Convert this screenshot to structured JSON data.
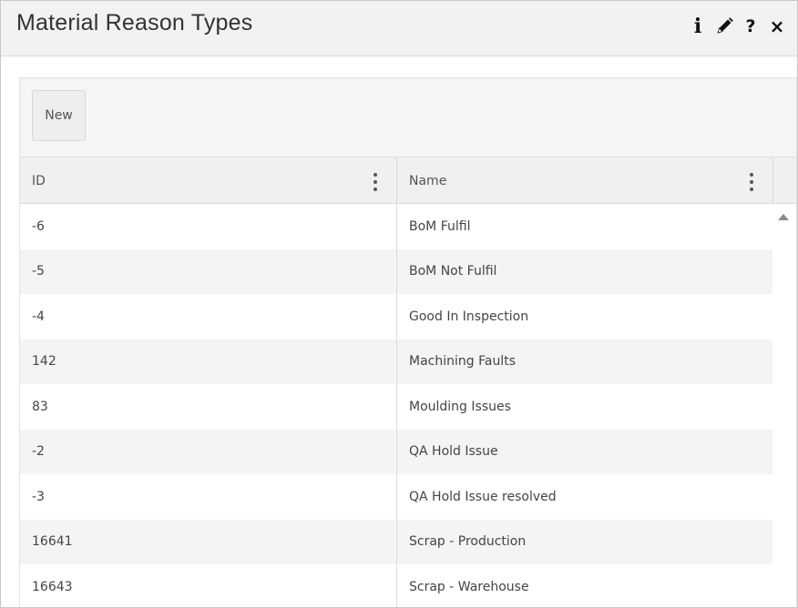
{
  "window": {
    "title": "Material Reason Types",
    "icons": {
      "info": "i",
      "edit": "edit-pencil",
      "help": "?",
      "close": "×"
    }
  },
  "toolbar": {
    "new_label": "New"
  },
  "grid": {
    "columns": [
      {
        "label": "ID"
      },
      {
        "label": "Name"
      }
    ],
    "rows": [
      {
        "id": "-6",
        "name": "BoM Fulfil"
      },
      {
        "id": "-5",
        "name": "BoM Not Fulfil"
      },
      {
        "id": "-4",
        "name": "Good In Inspection"
      },
      {
        "id": "142",
        "name": "Machining Faults"
      },
      {
        "id": "83",
        "name": "Moulding Issues"
      },
      {
        "id": "-2",
        "name": "QA Hold Issue"
      },
      {
        "id": "-3",
        "name": "QA Hold Issue resolved"
      },
      {
        "id": "16641",
        "name": "Scrap - Production"
      },
      {
        "id": "16643",
        "name": "Scrap - Warehouse"
      }
    ]
  }
}
